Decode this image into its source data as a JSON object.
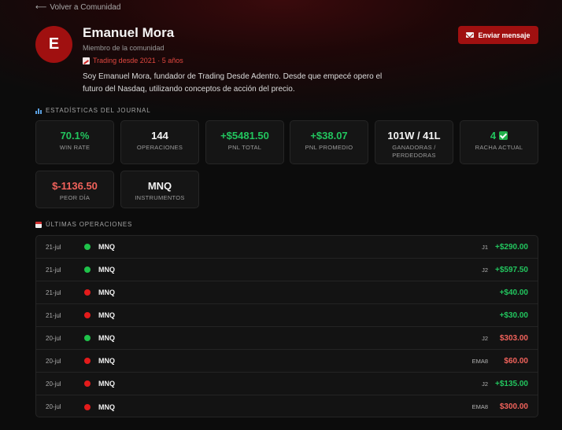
{
  "back_link": {
    "arrow": "⟵",
    "label": "Volver a Comunidad"
  },
  "profile": {
    "avatar_letter": "E",
    "name": "Emanuel Mora",
    "role": "Miembro de la comunidad",
    "since": "Trading desde 2021 · 5 años",
    "since_icon": "chart-up-icon",
    "bio": "Soy Emanuel Mora, fundador de Trading Desde Adentro. Desde que empecé opero el futuro del Nasdaq, utilizando conceptos de acción del precio."
  },
  "message_button": {
    "label": "Enviar mensaje",
    "icon": "mail-icon"
  },
  "stats_section": {
    "title": "ESTADÍSTICAS DEL JOURNAL",
    "icon": "bar-chart-icon"
  },
  "stats": [
    {
      "value": "70.1%",
      "label": "WIN RATE",
      "color": "#22c55e"
    },
    {
      "value": "144",
      "label": "OPERACIONES",
      "color": "#f4f4f4"
    },
    {
      "value": "+$5481.50",
      "label": "PNL TOTAL",
      "color": "#22c55e"
    },
    {
      "value": "+$38.07",
      "label": "PNL PROMEDIO",
      "color": "#22c55e"
    },
    {
      "value": "101W / 41L",
      "label": "GANADORAS / PERDEDORAS",
      "color": "#f4f4f4"
    },
    {
      "value": "4",
      "label": "RACHA ACTUAL",
      "color": "#22c55e",
      "icon": "check-icon"
    },
    {
      "value": "$-1136.50",
      "label": "PEOR DÍA",
      "color": "#f0625b"
    },
    {
      "value": "MNQ",
      "label": "INSTRUMENTOS",
      "color": "#f4f4f4"
    }
  ],
  "ops_section": {
    "title": "ÚLTIMAS OPERACIONES",
    "icon": "calendar-icon"
  },
  "operations": [
    {
      "date": "21-jul",
      "result": "win",
      "symbol": "MNQ",
      "tag": "J1",
      "pnl": "+$290.00",
      "pnl_color": "#22c55e"
    },
    {
      "date": "21-jul",
      "result": "win",
      "symbol": "MNQ",
      "tag": "J2",
      "pnl": "+$597.50",
      "pnl_color": "#22c55e"
    },
    {
      "date": "21-jul",
      "result": "loss",
      "symbol": "MNQ",
      "tag": "",
      "pnl": "+$40.00",
      "pnl_color": "#22c55e"
    },
    {
      "date": "21-jul",
      "result": "loss",
      "symbol": "MNQ",
      "tag": "",
      "pnl": "+$30.00",
      "pnl_color": "#22c55e"
    },
    {
      "date": "20-jul",
      "result": "win",
      "symbol": "MNQ",
      "tag": "J2",
      "pnl": "$303.00",
      "pnl_color": "#f0625b"
    },
    {
      "date": "20-jul",
      "result": "loss",
      "symbol": "MNQ",
      "tag": "EMA8",
      "pnl": "$60.00",
      "pnl_color": "#f0625b"
    },
    {
      "date": "20-jul",
      "result": "loss",
      "symbol": "MNQ",
      "tag": "J2",
      "pnl": "+$135.00",
      "pnl_color": "#22c55e"
    },
    {
      "date": "20-jul",
      "result": "loss",
      "symbol": "MNQ",
      "tag": "EMA8",
      "pnl": "$300.00",
      "pnl_color": "#f0625b"
    }
  ]
}
